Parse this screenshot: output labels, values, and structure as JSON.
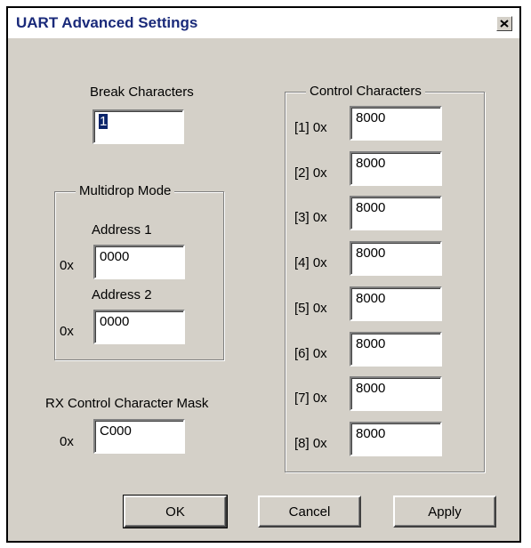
{
  "window": {
    "title": "UART Advanced Settings",
    "close_glyph": "✕"
  },
  "break": {
    "label": "Break Characters",
    "value": "1"
  },
  "multidrop": {
    "legend": "Multidrop Mode",
    "address1": {
      "label": "Address 1",
      "prefix": "0x",
      "value": "0000"
    },
    "address2": {
      "label": "Address 2",
      "prefix": "0x",
      "value": "0000"
    }
  },
  "rxmask": {
    "label": "RX Control Character Mask",
    "prefix": "0x",
    "value": "C000"
  },
  "control": {
    "legend": "Control Characters",
    "items": [
      {
        "label": "[1] 0x",
        "value": "8000"
      },
      {
        "label": "[2] 0x",
        "value": "8000"
      },
      {
        "label": "[3] 0x",
        "value": "8000"
      },
      {
        "label": "[4] 0x",
        "value": "8000"
      },
      {
        "label": "[5] 0x",
        "value": "8000"
      },
      {
        "label": "[6] 0x",
        "value": "8000"
      },
      {
        "label": "[7] 0x",
        "value": "8000"
      },
      {
        "label": "[8] 0x",
        "value": "8000"
      }
    ]
  },
  "buttons": {
    "ok": "OK",
    "cancel": "Cancel",
    "apply": "Apply"
  }
}
